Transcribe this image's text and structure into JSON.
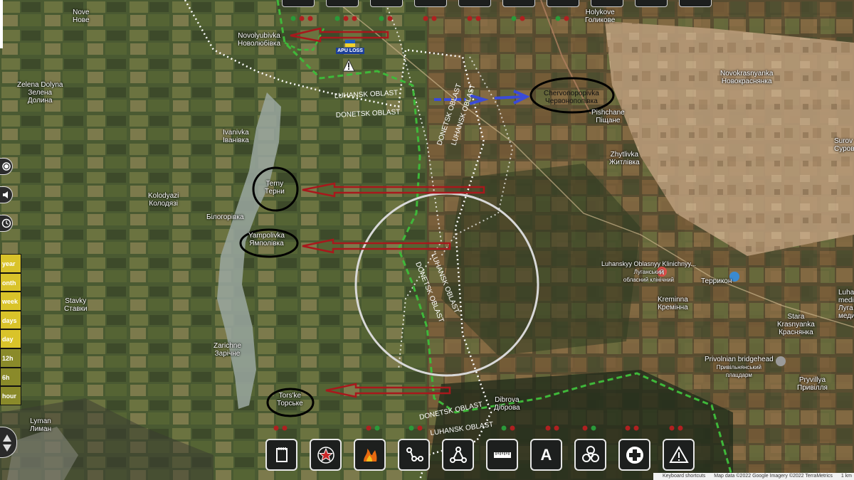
{
  "map": {
    "marker_label": "APU LOSS",
    "places": {
      "nove": "Nove",
      "nove_cyr": "Нове",
      "novolyubivka": "Novolyubivka",
      "novolyubivka_cyr": "Новолюбівка",
      "zelena_dolyna": "Zelena Dolyna",
      "zelena_dolyna_cyr1": "Зелена",
      "zelena_dolyna_cyr2": "Долина",
      "ivanivka": "Ivanivka",
      "ivanivka_cyr": "Іванівка",
      "terny": "Terny",
      "terny_cyr": "Терни",
      "kolodyazi": "Kolodyazi",
      "kolodyazi_cyr": "Колодязі",
      "bilohorivka_cyr": "Білогорівка",
      "yampolivka": "Yampolivka",
      "yampolivka_cyr": "Ямполівка",
      "stavky": "Stavky",
      "stavky_cyr": "Ставки",
      "zarichne": "Zarichne",
      "zarichne_cyr": "Зарічне",
      "torske": "Tors'ke",
      "torske_cyr": "Торське",
      "lyman": "Lyman",
      "lyman_cyr": "Лиман",
      "dibrova": "Dibrova",
      "dibrova_cyr": "Діброва",
      "holykove": "Holykove",
      "holykove_cyr": "Голикове",
      "novokrasnyanka": "Novokrasnyanka",
      "novokrasnyanka_cyr": "Новокраснянка",
      "chervonopopivka": "Chervonopopivka",
      "chervonopopivka_cyr": "Червонопопівка",
      "pishchane": "Pishchane",
      "pishchane_cyr": "Піщане",
      "zhytlivka": "Zhytlivka",
      "zhytlivka_cyr": "Житлівка",
      "hospital": "Luhanskyy Oblasnyy Klinichnyy...",
      "hospital_cyr1": "Луганський",
      "hospital_cyr2": "обласний клінічний",
      "terrykon": "Террикон",
      "kreminna": "Kreminna",
      "kreminna_cyr": "Кремінна",
      "bridgehead": "Privolnian bridgehead",
      "bridgehead_cyr1": "Привільнянський",
      "bridgehead_cyr2": "плацдарм",
      "pryvillya": "Pryvillya",
      "pryvillya_cyr": "Привілля",
      "krasnyanka": "Krasnyanka",
      "krasnyanka_cyr": "Краснянка",
      "stara": "Stara",
      "surov": "Surov",
      "surov_cyr": "Суров",
      "medical_partial": "Luha",
      "medical_partial2": "medical u",
      "medical_partial3": "Луга",
      "medical_partial4": "медичн"
    },
    "borders": {
      "luhansk_oblast": "LUHANSK OBLAST",
      "donetsk_oblast": "DONETSK OBLAST"
    }
  },
  "timeline": [
    "year",
    "onth",
    "week",
    "days",
    "day",
    "12h",
    "6h",
    "hour"
  ],
  "toolbar": [
    "doc-icon",
    "star-icon",
    "fire-icon",
    "route-icon",
    "network-icon",
    "ruler-icon",
    "text-icon",
    "biohazard-icon",
    "medical-cross-icon",
    "warning-icon"
  ],
  "toolbar_text": {
    "text_tool": "A"
  },
  "attribution": {
    "shortcuts": "Keyboard shortcuts",
    "imagery": "Map data ©2022 Google Imagery ©2022 TerraMetrics",
    "unit": "1 km"
  },
  "colors": {
    "front_line": "#3fb83a",
    "arrow_red": "#a8181c",
    "arrow_blue": "#3a4bd8",
    "oblast_border": "#ffffff",
    "selection_circle": "#d8d8d8",
    "timeline_yellow": "#d9c32a"
  }
}
